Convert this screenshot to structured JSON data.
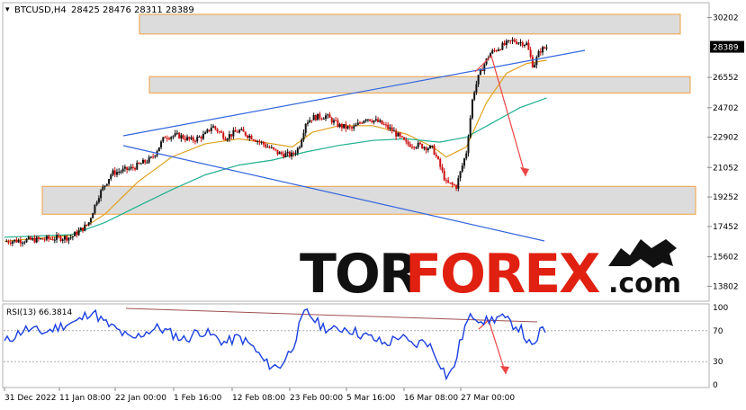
{
  "header": {
    "symbol_label": "BTCUSD,H4",
    "ohlc_values": "28425 28476 28311 28389"
  },
  "rsi_panel": {
    "label": "RSI(13) 66.3814"
  },
  "watermark": {
    "brand_left": "TOR",
    "brand_right": "FOREX",
    "brand_suffix": ".com"
  },
  "colors": {
    "candle_up": "#111111",
    "candle_down": "#cc1111",
    "ma_fast": "#e0a020",
    "ma_slow": "#20b090",
    "trend_line": "#3366dd",
    "zone_fill": "#dcdcdc",
    "zone_border": "#f0a040",
    "arrow": "#ee4444",
    "rsi_line": "#1a3fe0",
    "rsi_trend": "#a05050",
    "brand_dark": "#111111",
    "brand_red": "#e02010"
  },
  "chart_data": [
    {
      "type": "candlestick",
      "symbol": "BTCUSD",
      "timeframe": "H4",
      "ylim": [
        13000,
        31000
      ],
      "y_ticks": [
        30202,
        28389,
        26552,
        24702,
        22902,
        21052,
        19252,
        17452,
        15602,
        13802
      ],
      "last_price": 28389,
      "x_tick_labels": [
        "31 Dec 2022",
        "11 Jan 08:00",
        "22 Jan 00:00",
        "1 Feb 16:00",
        "12 Feb 08:00",
        "23 Feb 00:00",
        "5 Mar 16:00",
        "16 Mar 08:00",
        "27 Mar 00:00"
      ],
      "price_path": [
        [
          0,
          16550
        ],
        [
          10,
          16650
        ],
        [
          20,
          16800
        ],
        [
          25,
          17600
        ],
        [
          28,
          19300
        ],
        [
          32,
          20700
        ],
        [
          38,
          21000
        ],
        [
          44,
          21600
        ],
        [
          48,
          22950
        ],
        [
          52,
          23000
        ],
        [
          56,
          22700
        ],
        [
          60,
          23050
        ],
        [
          62,
          23600
        ],
        [
          66,
          22900
        ],
        [
          70,
          23300
        ],
        [
          74,
          22900
        ],
        [
          78,
          22400
        ],
        [
          82,
          21900
        ],
        [
          86,
          21800
        ],
        [
          88,
          22300
        ],
        [
          90,
          23800
        ],
        [
          92,
          24100
        ],
        [
          96,
          24200
        ],
        [
          100,
          23600
        ],
        [
          104,
          23400
        ],
        [
          108,
          24100
        ],
        [
          112,
          23800
        ],
        [
          116,
          23300
        ],
        [
          120,
          22500
        ],
        [
          124,
          22400
        ],
        [
          128,
          22200
        ],
        [
          130,
          21200
        ],
        [
          132,
          20100
        ],
        [
          135,
          19900
        ],
        [
          138,
          22000
        ],
        [
          140,
          25500
        ],
        [
          142,
          26800
        ],
        [
          145,
          28000
        ],
        [
          148,
          28400
        ],
        [
          152,
          28800
        ],
        [
          156,
          28600
        ],
        [
          158,
          27200
        ],
        [
          160,
          28200
        ],
        [
          162,
          28400
        ]
      ],
      "moving_averages": [
        {
          "path": [
            [
              0,
              16550
            ],
            [
              20,
              16900
            ],
            [
              30,
              18200
            ],
            [
              40,
              20200
            ],
            [
              50,
              21700
            ],
            [
              60,
              22500
            ],
            [
              70,
              22800
            ],
            [
              80,
              22500
            ],
            [
              86,
              22300
            ],
            [
              92,
              23200
            ],
            [
              100,
              23600
            ],
            [
              110,
              23600
            ],
            [
              120,
              23100
            ],
            [
              128,
              22300
            ],
            [
              132,
              21700
            ],
            [
              138,
              22300
            ],
            [
              144,
              25000
            ],
            [
              150,
              26800
            ],
            [
              156,
              27400
            ],
            [
              162,
              27600
            ]
          ]
        },
        {
          "path": [
            [
              0,
              16800
            ],
            [
              20,
              16950
            ],
            [
              30,
              17700
            ],
            [
              40,
              18700
            ],
            [
              50,
              19700
            ],
            [
              60,
              20600
            ],
            [
              70,
              21200
            ],
            [
              80,
              21500
            ],
            [
              90,
              22000
            ],
            [
              100,
              22400
            ],
            [
              110,
              22700
            ],
            [
              120,
              22800
            ],
            [
              130,
              22600
            ],
            [
              138,
              22900
            ],
            [
              146,
              23800
            ],
            [
              154,
              24700
            ],
            [
              162,
              25300
            ]
          ]
        }
      ],
      "zones": [
        {
          "from": 29200,
          "to": 30400
        },
        {
          "from": 25600,
          "to": 26600
        },
        {
          "from": 18200,
          "to": 19900
        }
      ]
    },
    {
      "type": "line",
      "name": "RSI(13)",
      "ylim": [
        0,
        100
      ],
      "y_ticks": [
        100,
        70,
        30,
        0
      ],
      "last_value": 66.3814,
      "path": [
        [
          0,
          55
        ],
        [
          6,
          72
        ],
        [
          12,
          68
        ],
        [
          18,
          78
        ],
        [
          22,
          82
        ],
        [
          26,
          96
        ],
        [
          30,
          80
        ],
        [
          34,
          70
        ],
        [
          38,
          58
        ],
        [
          42,
          68
        ],
        [
          46,
          74
        ],
        [
          50,
          66
        ],
        [
          54,
          58
        ],
        [
          58,
          70
        ],
        [
          62,
          64
        ],
        [
          66,
          54
        ],
        [
          70,
          62
        ],
        [
          74,
          50
        ],
        [
          78,
          28
        ],
        [
          82,
          22
        ],
        [
          86,
          48
        ],
        [
          88,
          74
        ],
        [
          90,
          96
        ],
        [
          94,
          78
        ],
        [
          98,
          70
        ],
        [
          102,
          74
        ],
        [
          106,
          66
        ],
        [
          110,
          60
        ],
        [
          114,
          52
        ],
        [
          118,
          64
        ],
        [
          122,
          50
        ],
        [
          126,
          58
        ],
        [
          130,
          30
        ],
        [
          132,
          12
        ],
        [
          134,
          18
        ],
        [
          136,
          52
        ],
        [
          138,
          80
        ],
        [
          140,
          90
        ],
        [
          144,
          82
        ],
        [
          148,
          88
        ],
        [
          152,
          78
        ],
        [
          154,
          74
        ],
        [
          156,
          58
        ],
        [
          158,
          45
        ],
        [
          160,
          70
        ],
        [
          162,
          66
        ]
      ]
    }
  ]
}
